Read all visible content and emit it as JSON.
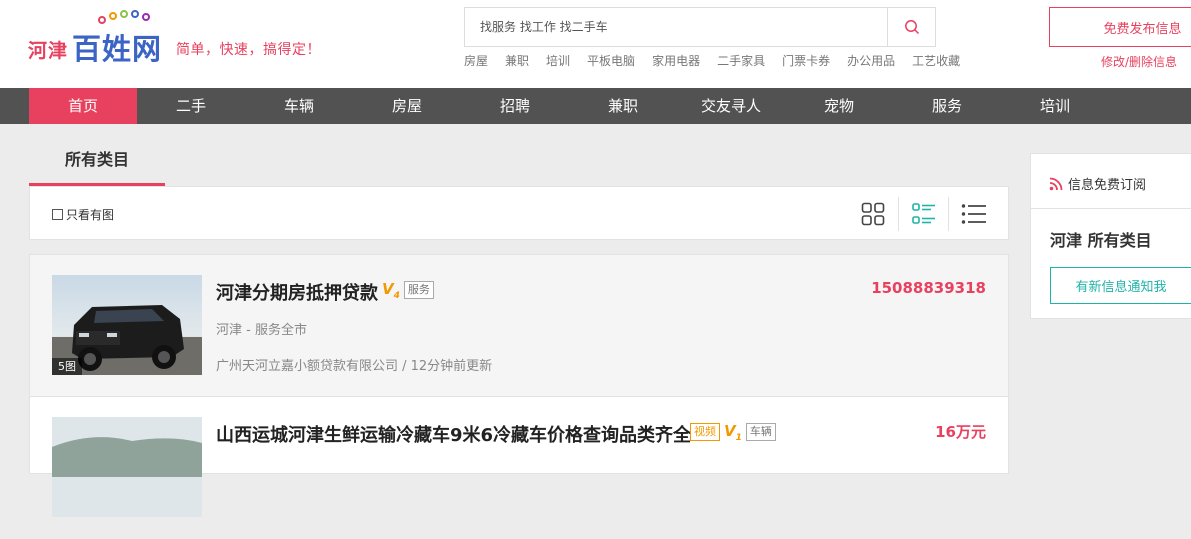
{
  "brand": {
    "city": "河津",
    "name": "百姓网",
    "slogan": "简单，快速，搞得定！"
  },
  "search": {
    "placeholder": "找服务 找工作 找二手车"
  },
  "quick_links": [
    "房屋",
    "兼职",
    "培训",
    "平板电脑",
    "家用电器",
    "二手家具",
    "门票卡券",
    "办公用品",
    "工艺收藏"
  ],
  "header_actions": {
    "post_label": "免费发布信息",
    "edit_label": "修改/删除信息"
  },
  "nav": {
    "items": [
      {
        "label": "首页",
        "active": true
      },
      {
        "label": "二手",
        "active": false
      },
      {
        "label": "车辆",
        "active": false
      },
      {
        "label": "房屋",
        "active": false
      },
      {
        "label": "招聘",
        "active": false
      },
      {
        "label": "兼职",
        "active": false
      },
      {
        "label": "交友寻人",
        "active": false
      },
      {
        "label": "宠物",
        "active": false
      },
      {
        "label": "服务",
        "active": false
      },
      {
        "label": "培训",
        "active": false
      }
    ]
  },
  "main": {
    "category_tab": "所有类目",
    "only_pic_label": "只看有图"
  },
  "listings": [
    {
      "title": "河津分期房抵押贷款",
      "v_badge": "V",
      "v_level": "4",
      "tag": "服务",
      "location": "河津 - 服务全市",
      "meta": "广州天河立嘉小额贷款有限公司 / 12分钟前更新",
      "price": "15088839318",
      "photo_count": "5图"
    },
    {
      "title": "山西运城河津生鲜运输冷藏车9米6冷藏车价格查询品类齐全",
      "video_tag": "视频",
      "v_badge": "V",
      "v_level": "1",
      "tag": "车辆",
      "price": "16万元"
    }
  ],
  "sidebar": {
    "heading": "信息免费订阅",
    "title": "河津 所有类目",
    "subscribe_label": "有新信息通知我"
  },
  "colors": {
    "brand_red": "#e8415f",
    "brand_blue": "#3b64c4",
    "nav_bg": "#525252",
    "teal": "#1fb4a8",
    "vip_orange": "#f39800"
  }
}
